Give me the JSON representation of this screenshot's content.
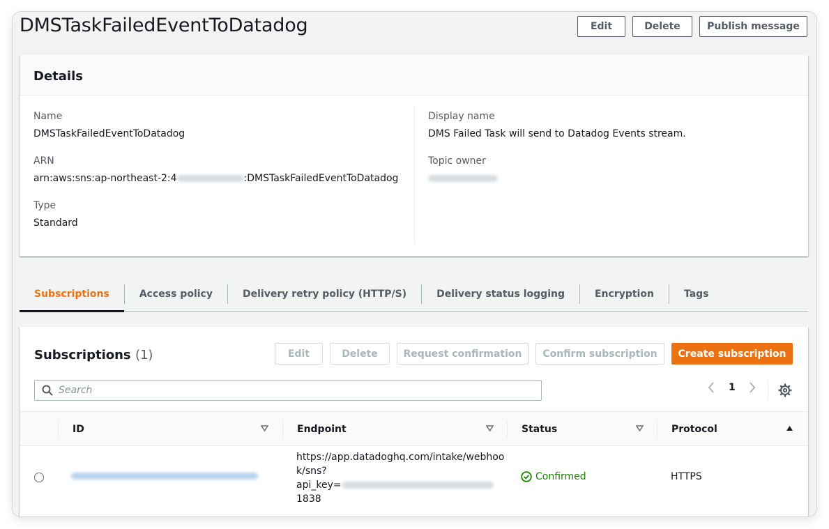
{
  "header": {
    "title": "DMSTaskFailedEventToDatadog",
    "edit_label": "Edit",
    "delete_label": "Delete",
    "publish_label": "Publish message"
  },
  "details": {
    "heading": "Details",
    "name_label": "Name",
    "name_value": "DMSTaskFailedEventToDatadog",
    "arn_label": "ARN",
    "arn_prefix": "arn:aws:sns:ap-northeast-2:4",
    "arn_suffix": ":DMSTaskFailedEventToDatadog",
    "type_label": "Type",
    "type_value": "Standard",
    "display_name_label": "Display name",
    "display_name_value": "DMS Failed Task will send to Datadog Events stream.",
    "topic_owner_label": "Topic owner"
  },
  "tabs": [
    {
      "label": "Subscriptions",
      "active": true
    },
    {
      "label": "Access policy",
      "active": false
    },
    {
      "label": "Delivery retry policy (HTTP/S)",
      "active": false
    },
    {
      "label": "Delivery status logging",
      "active": false
    },
    {
      "label": "Encryption",
      "active": false
    },
    {
      "label": "Tags",
      "active": false
    }
  ],
  "subscriptions": {
    "title": "Subscriptions",
    "count": "(1)",
    "edit_label": "Edit",
    "delete_label": "Delete",
    "request_confirmation_label": "Request confirmation",
    "confirm_subscription_label": "Confirm subscription",
    "create_subscription_label": "Create subscription",
    "search_placeholder": "Search",
    "page": "1",
    "columns": {
      "id": "ID",
      "endpoint": "Endpoint",
      "status": "Status",
      "protocol": "Protocol"
    },
    "rows": [
      {
        "endpoint_line1": "https://app.datadoghq.com/intake/webhoo",
        "endpoint_line2": "k/sns?",
        "endpoint_line3": "api_key=",
        "endpoint_line4": "1838",
        "status": "Confirmed",
        "protocol": "HTTPS"
      }
    ]
  },
  "colors": {
    "accent": "#ec7211",
    "success": "#1d8102",
    "text": "#16191f",
    "muted": "#545b64"
  }
}
